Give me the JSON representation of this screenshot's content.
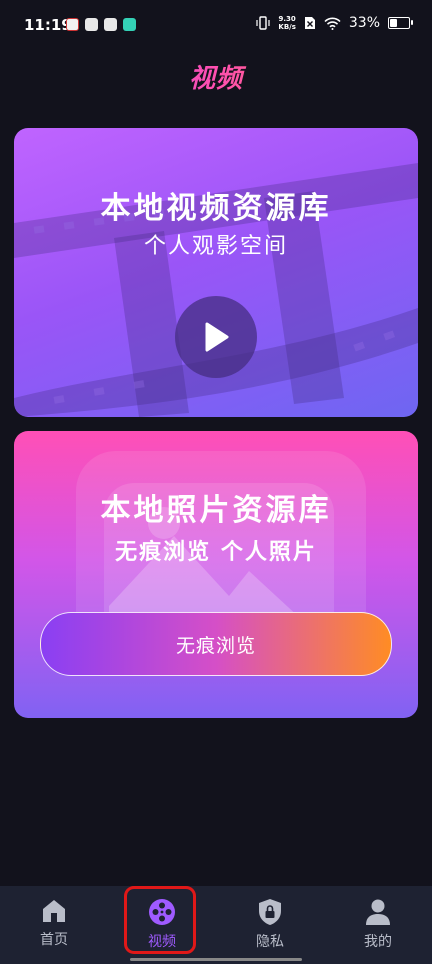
{
  "status_bar": {
    "time": "11:19",
    "net_speed_value": "9.30",
    "net_speed_unit": "KB/s",
    "battery": "33%",
    "battery_level": 0.33
  },
  "header": {
    "title": "视频"
  },
  "video_card": {
    "title": "本地视频资源库",
    "subtitle": "个人观影空间",
    "play_icon": "play-icon"
  },
  "photo_card": {
    "title": "本地照片资源库",
    "subtitle": "无痕浏览 个人照片",
    "button_label": "无痕浏览"
  },
  "bottom_nav": {
    "items": [
      {
        "label": "首页",
        "icon": "home-icon",
        "active": false
      },
      {
        "label": "视频",
        "icon": "film-reel-icon",
        "active": true
      },
      {
        "label": "隐私",
        "icon": "shield-lock-icon",
        "active": false
      },
      {
        "label": "我的",
        "icon": "user-icon",
        "active": false
      }
    ]
  },
  "colors": {
    "background": "#12121c",
    "accent": "#9f5bff",
    "highlight_box": "#e01818",
    "nav_background": "#1e2232"
  }
}
